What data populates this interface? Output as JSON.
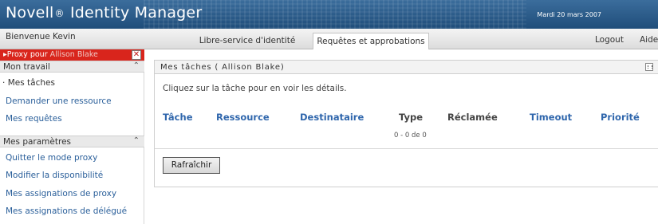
{
  "header": {
    "logo_prefix": "Novell",
    "logo_mark": "®",
    "logo_suffix": "Identity Manager",
    "date": "Mardi 20 mars 2007"
  },
  "tabbar": {
    "welcome": "Bienvenue Kevin",
    "tabs": [
      {
        "label": "Libre-service d'identité",
        "active": false
      },
      {
        "label": "Requêtes et approbations",
        "active": true
      }
    ],
    "logout": "Logout",
    "help": "Aide"
  },
  "sidebar": {
    "proxy_label": "Proxy pour",
    "proxy_name": "Allison Blake",
    "close_glyph": "✕",
    "sections": [
      {
        "title": "Mon travail",
        "items": [
          "Mes tâches",
          "Demander une ressource",
          "Mes requêtes"
        ]
      },
      {
        "title": "Mes paramètres",
        "items": [
          "Quitter le mode proxy",
          "Modifier la disponibilité",
          "Mes assignations de proxy",
          "Mes assignations de délégué"
        ]
      }
    ],
    "collapse_glyph": "⌃"
  },
  "panel": {
    "title": "Mes tâches ( Allison Blake)",
    "instructions": "Cliquez sur la tâche pour en voir les détails.",
    "columns": [
      "Tâche",
      "Ressource",
      "Destinataire",
      "Type",
      "Réclamée",
      "Timeout",
      "Priorité"
    ],
    "count": "0 - 0 de 0",
    "refresh_label": "Rafraîchir"
  },
  "colors": {
    "header_blue": "#1f4d7a",
    "proxy_red": "#d9251c",
    "link_blue": "#2a5f9a",
    "column_blue": "#2f66ac"
  }
}
